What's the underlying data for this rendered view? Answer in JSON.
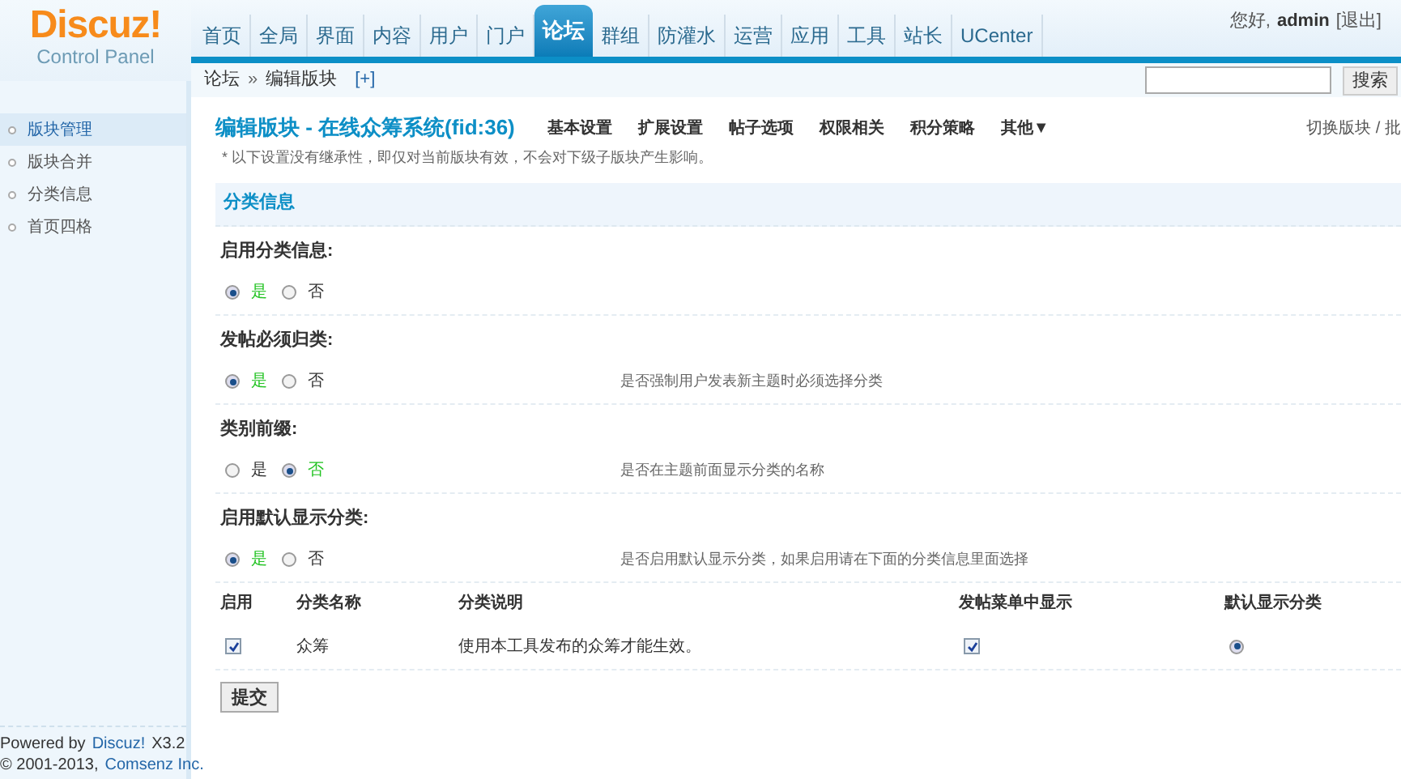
{
  "logo": {
    "title": "Discuz!",
    "subtitle": "Control Panel"
  },
  "nav": [
    {
      "label": "首页",
      "selected": false
    },
    {
      "label": "全局",
      "selected": false
    },
    {
      "label": "界面",
      "selected": false
    },
    {
      "label": "内容",
      "selected": false
    },
    {
      "label": "用户",
      "selected": false
    },
    {
      "label": "门户",
      "selected": false
    },
    {
      "label": "论坛",
      "selected": true
    },
    {
      "label": "群组",
      "selected": false
    },
    {
      "label": "防灌水",
      "selected": false
    },
    {
      "label": "运营",
      "selected": false
    },
    {
      "label": "应用",
      "selected": false
    },
    {
      "label": "工具",
      "selected": false
    },
    {
      "label": "站长",
      "selected": false
    },
    {
      "label": "UCenter",
      "selected": false
    }
  ],
  "user": {
    "greeting": "您好,",
    "name": "admin",
    "logout": "[退出]"
  },
  "breadcrumb": {
    "items": [
      "论坛",
      "编辑版块"
    ],
    "separator": "»",
    "add": "[+]"
  },
  "search": {
    "button": "搜索"
  },
  "sidebar": {
    "items": [
      {
        "label": "版块管理",
        "selected": true
      },
      {
        "label": "版块合并",
        "selected": false
      },
      {
        "label": "分类信息",
        "selected": false
      },
      {
        "label": "首页四格",
        "selected": false
      }
    ]
  },
  "footer": {
    "powered": "Powered by",
    "brand": "Discuz!",
    "version": "X3.2",
    "copyright": "© 2001-2013,",
    "company": "Comsenz Inc."
  },
  "page": {
    "title": "编辑版块 - 在线众筹系统(fid:36)",
    "tabs": [
      {
        "label": "基本设置",
        "selected": false
      },
      {
        "label": "扩展设置",
        "selected": false
      },
      {
        "label": "帖子选项",
        "selected": false
      },
      {
        "label": "权限相关",
        "selected": false
      },
      {
        "label": "积分策略",
        "selected": false
      },
      {
        "label": "其他▼",
        "selected": false
      }
    ],
    "switch": "切换版块 / 批",
    "note": "*  以下设置没有继承性，即仅对当前版块有效，不会对下级子版块产生影响。"
  },
  "section": {
    "title": "分类信息"
  },
  "settings": [
    {
      "label": "启用分类信息:",
      "options": [
        {
          "label": "是",
          "selected": true
        },
        {
          "label": "否",
          "selected": false
        }
      ]
    },
    {
      "label": "发帖必须归类:",
      "options": [
        {
          "label": "是",
          "selected": true
        },
        {
          "label": "否",
          "selected": false
        }
      ],
      "description": "是否强制用户发表新主题时必须选择分类"
    },
    {
      "label": "类别前缀:",
      "options": [
        {
          "label": "是",
          "selected": false
        },
        {
          "label": "否",
          "selected": true
        }
      ],
      "description": "是否在主题前面显示分类的名称"
    },
    {
      "label": "启用默认显示分类:",
      "options": [
        {
          "label": "是",
          "selected": true
        },
        {
          "label": "否",
          "selected": false
        }
      ],
      "description": "是否启用默认显示分类，如果启用请在下面的分类信息里面选择"
    }
  ],
  "table": {
    "columns": [
      "启用",
      "分类名称",
      "分类说明",
      "发帖菜单中显示",
      "默认显示分类"
    ],
    "rows": [
      {
        "enabled": true,
        "name": "众筹",
        "description": "使用本工具发布的众筹才能生效。",
        "show_in_menu": true,
        "default": true
      }
    ]
  },
  "submit": "提交"
}
